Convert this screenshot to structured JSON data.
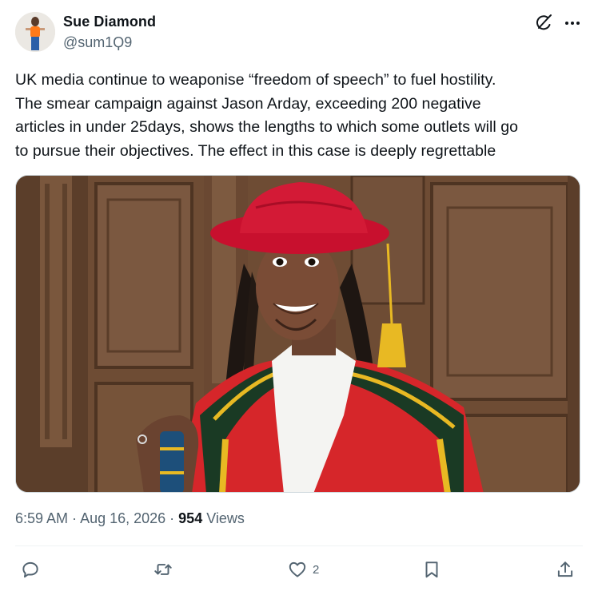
{
  "author": {
    "name": "Sue Diamond",
    "handle": "@sum1Ϙ9"
  },
  "icons": {
    "avatar": "profile-photo",
    "grok": "grok-icon",
    "more": "more-horizontal-icon",
    "reply": "speech-bubble-icon",
    "repost": "repost-arrows-icon",
    "like": "heart-icon",
    "bookmark": "bookmark-icon",
    "share": "share-upload-icon"
  },
  "tweet": {
    "lines": [
      "UK media continue to weaponise “freedom of speech” to fuel hostility.",
      "The smear campaign against Jason Arday, exceeding 200 negative",
      "articles in under 25days, shows the lengths to which some outlets will go",
      "to pursue their objectives. The effect in this case is deeply regrettable"
    ]
  },
  "meta": {
    "time": "6:59 AM",
    "sep1": " · ",
    "date": "Aug 16, 2026",
    "sep2": " · ",
    "views_count": "954",
    "views_label": " Views"
  },
  "actions": {
    "likes": "2"
  },
  "colors": {
    "text": "#0f1419",
    "secondary": "#536471",
    "robe_red": "#d92a2a",
    "hat_red": "#c8102e",
    "gold": "#e8b923",
    "panel_wood": "#6b4a33"
  }
}
